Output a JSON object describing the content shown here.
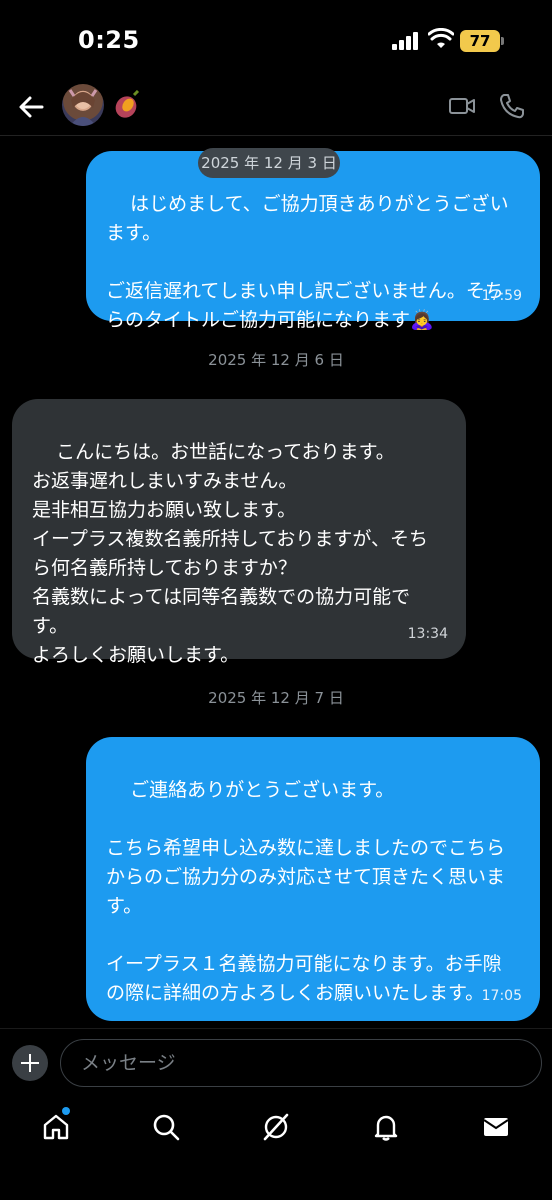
{
  "status_bar": {
    "time": "0:25",
    "battery": "77"
  },
  "header": {
    "avatar_icon": "profile-avatar",
    "emoji_icon": "sweet-potato-emoji"
  },
  "messages": [
    {
      "direction": "out",
      "text": "はじめまして、ご協力頂きありがとうございます。\n\nご返信遅れてしまい申し訳ございません。そちらのタイトルご協力可能になります🙇‍♀️",
      "time": "17:59"
    },
    {
      "direction": "in",
      "text": "こんにちは。お世話になっております。\nお返事遅れしまいすみません。\n是非相互協力お願い致します。\nイープラス複数名義所持しておりますが、そちら何名義所持しておりますか？\n名義数によっては同等名義数での協力可能です。\nよろしくお願いします。",
      "time": "13:34"
    },
    {
      "direction": "out",
      "text": "ご連絡ありがとうございます。\n\nこちら希望申し込み数に達しましたのでこちらからのご協力分のみ対応させて頂きたく思います。\n\nイープラス１名義協力可能になります。お手隙の際に詳細の方よろしくお願いいたします。",
      "time": "17:05"
    }
  ],
  "dates": {
    "d1": "2025 年 12 月 3 日",
    "d2": "2025 年 12 月 6 日",
    "d3": "2025 年 12 月 7 日"
  },
  "composer": {
    "placeholder": "メッセージ"
  },
  "nav": {
    "items": [
      "home-icon",
      "search-icon",
      "grok-icon",
      "notifications-icon",
      "messages-icon"
    ]
  },
  "colors": {
    "accent": "#1d9bf0",
    "incoming": "#2f3336",
    "battery": "#f2c94c"
  }
}
